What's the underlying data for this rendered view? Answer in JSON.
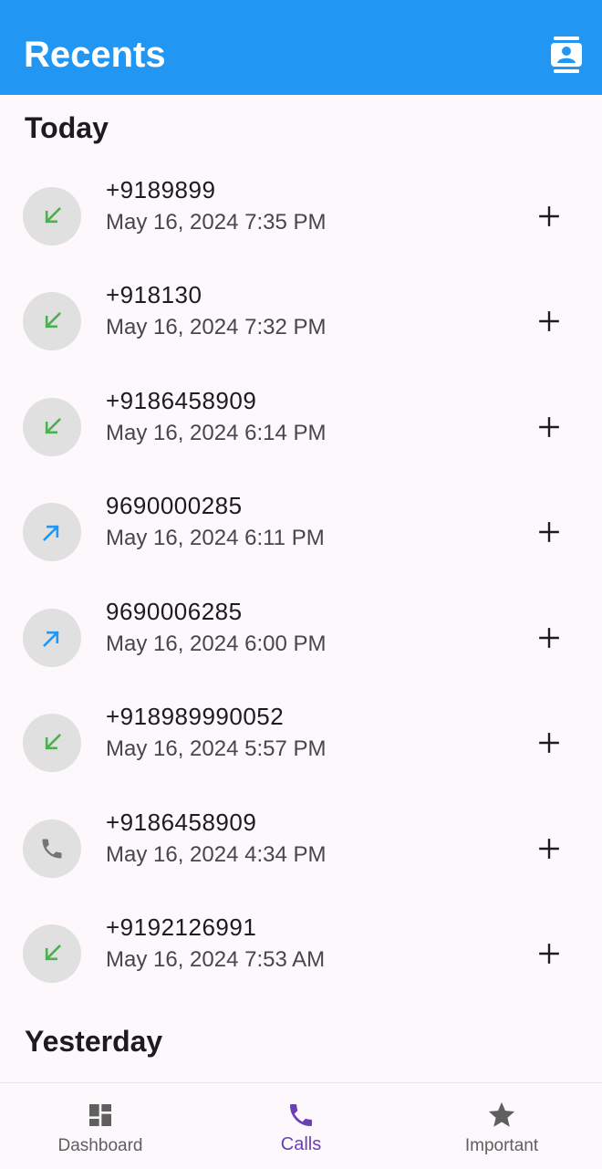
{
  "app_bar": {
    "title": "Recents",
    "contacts_icon": "contact-book-icon"
  },
  "sections": [
    {
      "label": "Today",
      "calls": [
        {
          "number": "+9189899",
          "time": "May 16, 2024 7:35 PM",
          "type": "incoming",
          "icon": "incoming-call-icon"
        },
        {
          "number": "+918130",
          "time": "May 16, 2024 7:32 PM",
          "type": "incoming",
          "icon": "incoming-call-icon"
        },
        {
          "number": "+9186458909",
          "time": "May 16, 2024 6:14 PM",
          "type": "incoming",
          "icon": "incoming-call-icon"
        },
        {
          "number": "9690000285",
          "time": "May 16, 2024 6:11 PM",
          "type": "outgoing",
          "icon": "outgoing-call-icon"
        },
        {
          "number": "9690006285",
          "time": "May 16, 2024 6:00 PM",
          "type": "outgoing",
          "icon": "outgoing-call-icon"
        },
        {
          "number": "+918989990052",
          "time": "May 16, 2024 5:57 PM",
          "type": "incoming",
          "icon": "incoming-call-icon"
        },
        {
          "number": "+9186458909",
          "time": "May 16, 2024 4:34 PM",
          "type": "other",
          "icon": "phone-icon"
        },
        {
          "number": "+9192126991",
          "time": "May 16, 2024 7:53 AM",
          "type": "incoming",
          "icon": "incoming-call-icon"
        }
      ]
    },
    {
      "label": "Yesterday",
      "calls": []
    }
  ],
  "bottom_nav": [
    {
      "label": "Dashboard",
      "icon": "dashboard-icon",
      "active": false
    },
    {
      "label": "Calls",
      "icon": "phone-icon",
      "active": true
    },
    {
      "label": "Important",
      "icon": "star-icon",
      "active": false
    }
  ],
  "colors": {
    "app_bar": "#2196f3",
    "incoming": "#4caf50",
    "outgoing": "#2196f3",
    "neutral_icon": "#757575",
    "nav_active": "#6a3fb5",
    "nav_inactive": "#5f5f5f"
  }
}
